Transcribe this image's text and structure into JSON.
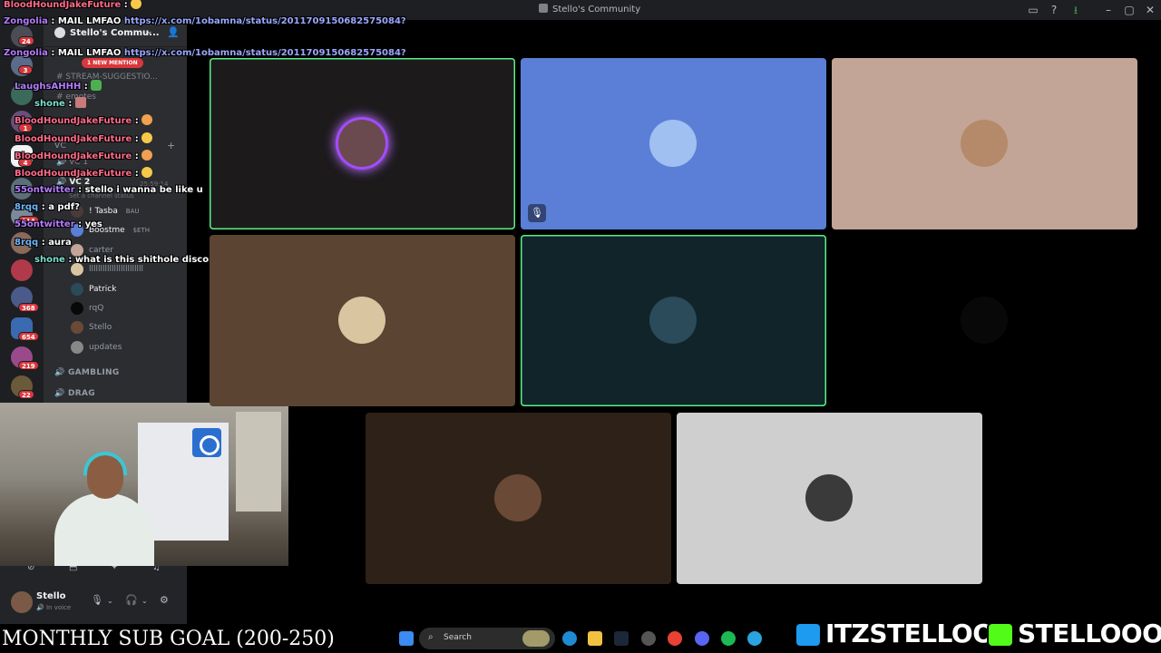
{
  "window": {
    "title": "Stello's Community",
    "controls": [
      "–",
      "▢",
      "✕"
    ]
  },
  "server": {
    "name": "Stello's Commu...",
    "new_mention": "1 NEW MENTION",
    "channels": [
      "STREAM-SUGGESTIO...",
      "emotes"
    ],
    "vc_category": "VC",
    "voice_channels": [
      "VC 1",
      "VC 2"
    ],
    "vc_timer": "25:59:14",
    "vc_status_placeholder": "Set a channel status",
    "vc_users": [
      "! Tasba",
      "Boostme",
      "carter",
      "llllllllllllllllllllllll",
      "Patrick",
      "rqQ",
      "Stello",
      "updates"
    ],
    "vc_user_tags": {
      "tasba": "BAU",
      "boostme": "$ETH"
    },
    "categories": [
      "GAMBLING",
      "DRAG"
    ]
  },
  "rail": {
    "badges": [
      "24",
      "3",
      "1",
      "4",
      "314",
      "368",
      "654",
      "219",
      "22"
    ]
  },
  "user_panel": {
    "name": "Stello",
    "status": "In voice"
  },
  "chat": [
    {
      "user": "BloodHoundJakeFuture",
      "color": "pink",
      "msg": ""
    },
    {
      "user": "Zongolia",
      "color": "purple",
      "msg": "MAIL LMFAO",
      "url": "https://x.com/1obamna/status/2011709150682575084?"
    },
    {
      "user": "Zongolia",
      "color": "purple",
      "msg": "MAIL LMFAO",
      "url": "https://x.com/1obamna/status/2011709150682575084?"
    },
    {
      "user": "LaughsAHHH",
      "color": "purple",
      "msg": ""
    },
    {
      "user": "shone",
      "color": "teal",
      "msg": ""
    },
    {
      "user": "BloodHoundJakeFuture",
      "color": "pink",
      "msg": ""
    },
    {
      "user": "BloodHoundJakeFuture",
      "color": "pink",
      "msg": ""
    },
    {
      "user": "BloodHoundJakeFuture",
      "color": "pink",
      "msg": ""
    },
    {
      "user": "BloodHoundJakeFuture",
      "color": "pink",
      "msg": ""
    },
    {
      "user": "55ontwitter",
      "color": "purple",
      "msg": "stello i wanna be like u"
    },
    {
      "user": "8rqq",
      "color": "blue",
      "msg": "a pdf?"
    },
    {
      "user": "55ontwitter",
      "color": "purple",
      "msg": "yes"
    },
    {
      "user": "8rqq",
      "color": "blue",
      "msg": "aura"
    },
    {
      "user": "shone",
      "color": "teal",
      "msg": "what is this shithole discord segment"
    }
  ],
  "tiles": [
    {
      "bg": "#1c1a1b",
      "speaking": true,
      "ring": true,
      "avatar": "#6b4a4f"
    },
    {
      "bg": "#5b7fd6",
      "speaking": false,
      "muted": true,
      "avatar": "#9fc0f0"
    },
    {
      "bg": "#c2a596",
      "speaking": false,
      "avatar": "#b58a6a"
    },
    {
      "bg": "#5b4431",
      "speaking": false,
      "avatar": "#d9c5a0"
    },
    {
      "bg": "#10242a",
      "speaking": true,
      "avatar": "#2b4a5a"
    },
    {
      "bg": "#000000",
      "speaking": false,
      "avatar": "#080808"
    },
    {
      "bg": "#2e2117",
      "speaking": false,
      "avatar": "#6a4a36"
    },
    {
      "bg": "#cfcfcf",
      "speaking": false,
      "avatar": "#3a3a3a"
    }
  ],
  "overlay": {
    "sub_goal": "MONTHLY SUB GOAL (200-250)",
    "twitter_handle": "ITZSTELLOO",
    "kick_handle": "STELLOOO"
  },
  "taskbar": {
    "search_label": "Search"
  },
  "colors": {
    "twitter_blue": "#1d9bf0",
    "kick_green": "#53fc18",
    "discord_bg": "#2b2d31",
    "speaking_green": "#57f287",
    "mention_red": "#da373c"
  }
}
